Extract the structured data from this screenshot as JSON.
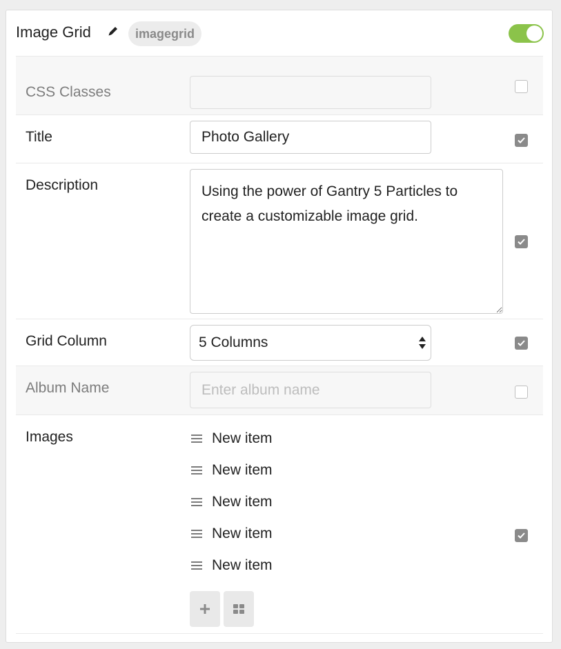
{
  "panel": {
    "title": "Image Grid",
    "slug": "imagegrid",
    "enabled": true,
    "toggle_color": "#8bc34a",
    "icons": {
      "edit": "pencil-icon"
    }
  },
  "fields": {
    "css_classes": {
      "label": "CSS Classes",
      "value": "",
      "checked": false
    },
    "title": {
      "label": "Title",
      "value": "Photo Gallery",
      "checked": true
    },
    "description": {
      "label": "Description",
      "value": "Using the power of Gantry 5 Particles to create a customizable image grid.",
      "checked": true
    },
    "grid_column": {
      "label": "Grid Column",
      "value": "5 Columns",
      "checked": true
    },
    "album_name": {
      "label": "Album Name",
      "value": "",
      "placeholder": "Enter album name",
      "checked": false
    },
    "images": {
      "label": "Images",
      "checked": true,
      "items": [
        "New item",
        "New item",
        "New item",
        "New item",
        "New item"
      ],
      "icons": {
        "drag": "drag-handle-icon",
        "add": "plus-icon",
        "bulk": "grid-icon"
      }
    }
  }
}
